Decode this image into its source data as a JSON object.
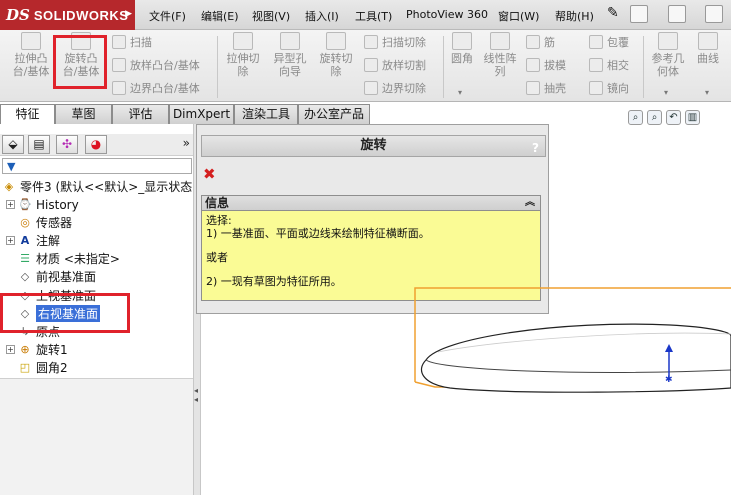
{
  "app": {
    "logo_text": "SOLIDWORKS",
    "logo_mark": "DS"
  },
  "menu": {
    "items": [
      "文件(F)",
      "编辑(E)",
      "视图(V)",
      "插入(I)",
      "工具(T)",
      "PhotoView 360",
      "窗口(W)",
      "帮助(H)"
    ]
  },
  "toolbar": {
    "extrude_boss": "拉伸凸\n台/基体",
    "revolve_boss": "旋转凸\n台/基体",
    "sweep": "扫描",
    "loft_boss": "放样凸台/基体",
    "boundary_boss": "边界凸台/基体",
    "extrude_cut": "拉伸切\n除",
    "hole_wizard": "异型孔\n向导",
    "revolve_cut": "旋转切\n除",
    "sweep_cut": "扫描切除",
    "loft_cut": "放样切割",
    "boundary_cut": "边界切除",
    "fillet": "圆角",
    "linear_pattern": "线性阵\n列",
    "rib": "筋",
    "draft": "拔模",
    "shell": "抽壳",
    "wrap": "包覆",
    "intersect": "相交",
    "mirror": "镜向",
    "ref_geometry": "参考几\n何体",
    "curves": "曲线"
  },
  "tabs": [
    "特征",
    "草图",
    "评估",
    "DimXpert",
    "渲染工具",
    "办公室产品"
  ],
  "tree": {
    "root": "零件3 (默认<<默认>_显示状态",
    "items": [
      {
        "label": "History",
        "expandable": true,
        "icon": "history-icon"
      },
      {
        "label": "传感器",
        "expandable": false,
        "icon": "sensor-icon"
      },
      {
        "label": "注解",
        "expandable": true,
        "icon": "annotation-icon"
      },
      {
        "label": "材质 <未指定>",
        "expandable": false,
        "icon": "material-icon"
      },
      {
        "label": "前视基准面",
        "expandable": false,
        "icon": "plane-icon"
      },
      {
        "label": "上视基准面",
        "expandable": false,
        "icon": "plane-icon"
      },
      {
        "label": "右视基准面",
        "expandable": false,
        "icon": "plane-icon",
        "selected": true
      },
      {
        "label": "原点",
        "expandable": false,
        "icon": "origin-icon"
      },
      {
        "label": "旋转1",
        "expandable": true,
        "icon": "revolve-icon"
      },
      {
        "label": "圆角2",
        "expandable": false,
        "icon": "fillet-icon"
      }
    ]
  },
  "property_manager": {
    "title": "旋转",
    "help": "?",
    "info_header": "信息",
    "info_lines": [
      "选择:",
      "1) 一基准面、平面或边线来绘制特征横断面。",
      "",
      "或者",
      "",
      "2) 一现有草图为特征所用。"
    ]
  },
  "colors": {
    "logo_bg": "#b6282c",
    "highlight_box": "#e0222b",
    "info_bg": "#fafb95",
    "selection": "#3a6fd8",
    "model_edge": "#f0a030"
  }
}
